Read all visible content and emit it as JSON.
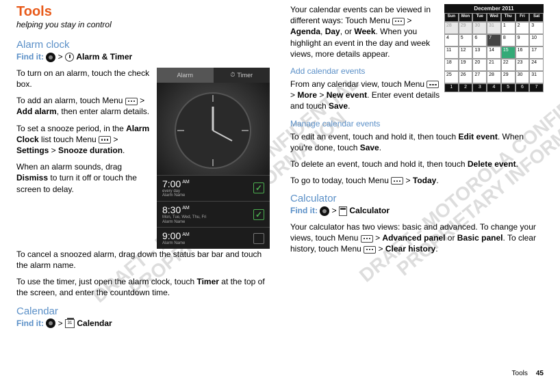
{
  "page": {
    "footer_label": "Tools",
    "footer_page": "45"
  },
  "title": "Tools",
  "subtitle": "helping you stay in control",
  "watermark": "DRAFT - MOTOROLA CONFIDENTIAL\nPROPRIETARY INFORMATION",
  "alarm": {
    "heading": "Alarm clock",
    "findit": "Find it:",
    "app": "Alarm & Timer",
    "p1a": "To turn on an alarm, touch the check box.",
    "p2a": "To add an alarm, touch Menu",
    "p2b": "Add alarm",
    "p2c": ", then enter alarm details.",
    "p3a": "To set a snooze period, in the ",
    "p3b": "Alarm Clock",
    "p3c": " list touch Menu",
    "p3d": "Settings",
    "p3e": "Snooze duration",
    "p4a": "When an alarm sounds, drag ",
    "p4b": "Dismiss",
    "p4c": " to turn it off or touch the screen to delay.",
    "p5": "To cancel a snoozed alarm, drag down the status bar bar and touch the alarm name.",
    "p6a": "To use the timer, just open the alarm clock, touch ",
    "p6b": "Timer",
    "p6c": " at the top of the screen, and enter the countdown time.",
    "mock": {
      "tab_alarm": "Alarm",
      "tab_timer": "Timer",
      "rows": [
        {
          "time": "7:00",
          "ampm": "AM",
          "days": "every day",
          "name": "Alarm Name",
          "checked": true
        },
        {
          "time": "8:30",
          "ampm": "AM",
          "days": "Mon, Tue, Wed, Thu, Fri",
          "name": "Alarm Name",
          "checked": true
        },
        {
          "time": "9:00",
          "ampm": "AM",
          "days": "",
          "name": "Alarm Name",
          "checked": false
        }
      ]
    }
  },
  "calendar": {
    "heading": "Calendar",
    "findit": "Find it:",
    "app": "Calendar",
    "p1a": "Your calendar events can be viewed in different ways: Touch Menu",
    "p1b": "Agenda",
    "p1c": "Day",
    "p1d": "Week",
    "p1e": ". When you highlight an event in the day and week views, more details appear.",
    "add_heading": "Add calendar events",
    "p2a": "From any calendar view, touch Menu",
    "p2b": "More",
    "p2c": "New event",
    "p2d": ". Enter event details and touch ",
    "p2e": "Save",
    "manage_heading": "Manage calendar events",
    "p3a": "To edit an event, touch and hold it, then touch ",
    "p3b": "Edit event",
    "p3c": ". When you're done, touch ",
    "p3d": "Save",
    "p4a": "To delete an event, touch and hold it, then touch ",
    "p4b": "Delete event",
    "p5a": "To go to today, touch Menu",
    "p5b": "Today",
    "mock": {
      "title": "December 2011",
      "dow": [
        "Sun",
        "Mon",
        "Tue",
        "Wed",
        "Thu",
        "Fri",
        "Sat"
      ],
      "weeks": [
        [
          "28",
          "29",
          "30",
          "31",
          "1",
          "2",
          "3"
        ],
        [
          "4",
          "5",
          "6",
          "7",
          "8",
          "9",
          "10"
        ],
        [
          "11",
          "12",
          "13",
          "14",
          "15",
          "16",
          "17"
        ],
        [
          "18",
          "19",
          "20",
          "21",
          "22",
          "23",
          "24"
        ],
        [
          "25",
          "26",
          "27",
          "28",
          "29",
          "30",
          "31"
        ]
      ],
      "bottom": [
        "1",
        "2",
        "3",
        "4",
        "5",
        "6",
        "7"
      ]
    }
  },
  "calculator": {
    "heading": "Calculator",
    "findit": "Find it:",
    "app": "Calculator",
    "p1a": "Your calculator has two views: basic and advanced. To change your views, touch Menu",
    "p1b": "Advanced panel",
    "p1c": "Basic panel",
    "p1d": ". To clear history, touch Menu",
    "p1e": "Clear history"
  }
}
